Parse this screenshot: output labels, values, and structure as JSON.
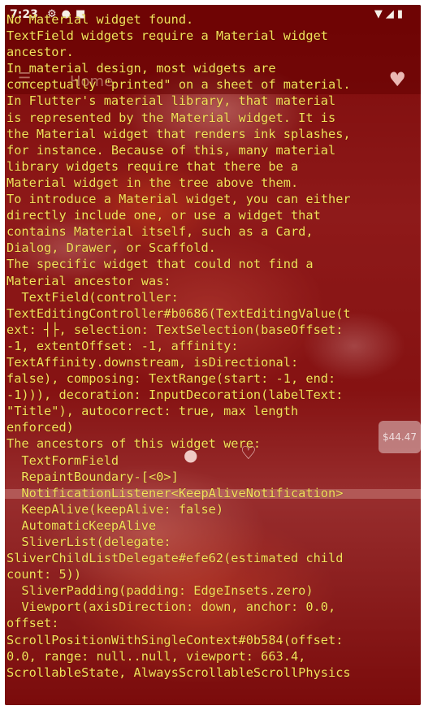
{
  "status_bar": {
    "time": "7:23",
    "left_icons": [
      "gear-icon",
      "circle-icon",
      "square-icon"
    ],
    "right_icons": [
      "wifi-icon",
      "signal-icon",
      "battery-icon"
    ]
  },
  "background": {
    "app_bar_title_faint": "Home",
    "price_faint": "$44.47"
  },
  "error": {
    "lines": [
      "No Material widget found.",
      "TextField widgets require a Material widget",
      "ancestor.",
      "In material design, most widgets are",
      "conceptually \"printed\" on a sheet of material.",
      "In Flutter's material library, that material",
      "is represented by the Material widget. It is",
      "the Material widget that renders ink splashes,",
      "for instance. Because of this, many material",
      "library widgets require that there be a",
      "Material widget in the tree above them.",
      "To introduce a Material widget, you can either",
      "directly include one, or use a widget that",
      "contains Material itself, such as a Card,",
      "Dialog, Drawer, or Scaffold.",
      "The specific widget that could not find a",
      "Material ancestor was:",
      "  TextField(controller:",
      "TextEditingController#b0686(TextEditingValue(t",
      "ext: ┤├, selection: TextSelection(baseOffset:",
      "-1, extentOffset: -1, affinity:",
      "TextAffinity.downstream, isDirectional:",
      "false), composing: TextRange(start: -1, end:",
      "-1))), decoration: InputDecoration(labelText:",
      "\"Title\"), autocorrect: true, max length",
      "enforced)",
      "The ancestors of this widget were:",
      "  TextFormField",
      "  RepaintBoundary-[<0>]",
      "  NotificationListener<KeepAliveNotification>",
      "  KeepAlive(keepAlive: false)",
      "  AutomaticKeepAlive",
      "  SliverList(delegate:",
      "SliverChildListDelegate#efe62(estimated child",
      "count: 5))",
      "  SliverPadding(padding: EdgeInsets.zero)",
      "  Viewport(axisDirection: down, anchor: 0.0,",
      "offset:",
      "ScrollPositionWithSingleContext#0b584(offset:",
      "0.0, range: null..null, viewport: 663.4,",
      "ScrollableState, AlwaysScrollableScrollPhysics"
    ]
  },
  "colors": {
    "error_text": "#f3e35a",
    "overlay": "#960000"
  }
}
